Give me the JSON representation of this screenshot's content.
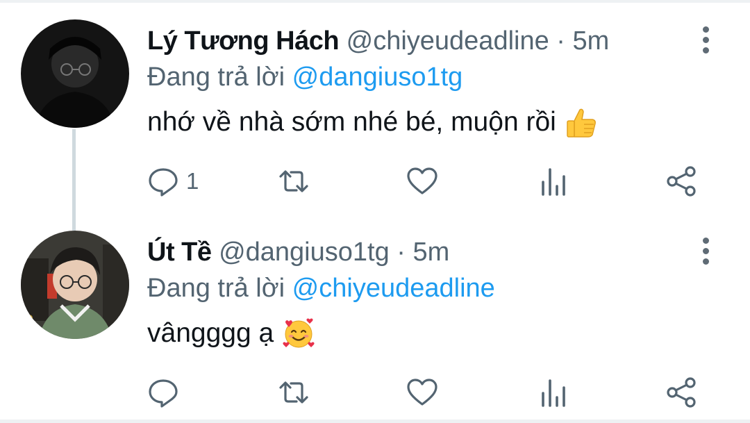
{
  "tweets": [
    {
      "display_name": "Lý Tương Hách",
      "handle": "@chiyeudeadline",
      "separator": "·",
      "time": "5m",
      "reply_prefix": "Đang trả lời",
      "reply_to": "@dangiuso1tg",
      "text": "nhớ về nhà sớm nhé bé, muộn rồi",
      "emoji": "thumbs-up-icon",
      "reply_count": "1"
    },
    {
      "display_name": "Út Tề",
      "handle": "@dangiuso1tg",
      "separator": "·",
      "time": "5m",
      "reply_prefix": "Đang trả lời",
      "reply_to": "@chiyeudeadline",
      "text": "vângggg ạ",
      "emoji": "smiling-face-with-hearts-icon",
      "reply_count": ""
    }
  ],
  "colors": {
    "name": "#0f1419",
    "secondary": "#536471",
    "link": "#1d9bf0",
    "thread_line": "#cfd9de"
  }
}
